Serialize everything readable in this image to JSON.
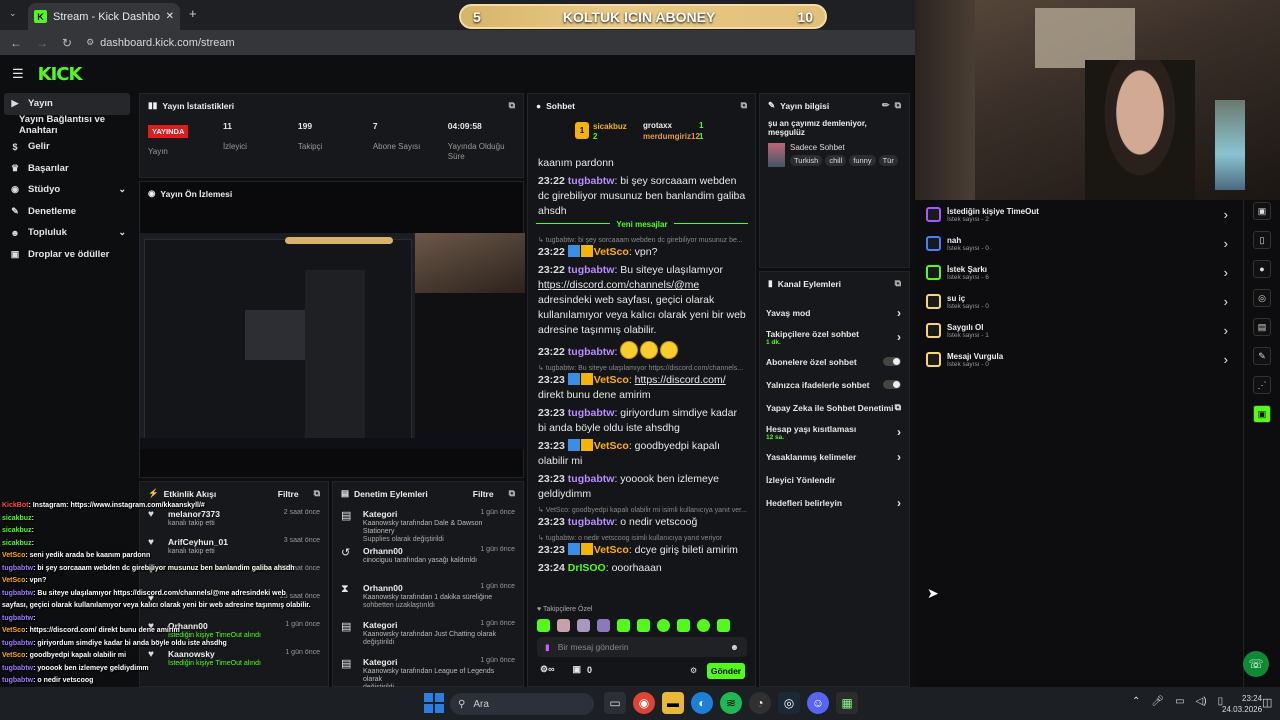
{
  "browser": {
    "tab_title": "Stream - Kick Dashboard",
    "url": "dashboard.kick.com/stream"
  },
  "goal_overlay": {
    "current": "5",
    "label": "KOLTUK ICIN ABONEY",
    "target": "10"
  },
  "sidebar": {
    "items": [
      {
        "label": "Yayın",
        "icon": "video-icon"
      },
      {
        "label": "Yayın Bağlantısı ve Anahtarı",
        "icon": ""
      },
      {
        "label": "Gelir",
        "icon": "dollar-icon"
      },
      {
        "label": "Başarılar",
        "icon": "trophy-icon"
      },
      {
        "label": "Stüdyo",
        "icon": "palette-icon"
      },
      {
        "label": "Denetleme",
        "icon": "wrench-icon"
      },
      {
        "label": "Topluluk",
        "icon": "users-icon"
      },
      {
        "label": "Droplar ve ödüller",
        "icon": "gift-icon"
      }
    ]
  },
  "stats": {
    "title": "Yayın İstatistikleri",
    "live": "YAYINDA",
    "live_label": "Yayın",
    "viewers": "11",
    "viewers_label": "İzleyici",
    "followers": "199",
    "followers_label": "Takipçi",
    "subs": "7",
    "subs_label": "Abone Sayısı",
    "uptime": "04:09:58",
    "uptime_label": "Yayında Olduğu Süre"
  },
  "preview": {
    "title": "Yayın Ön İzlemesi"
  },
  "activity": {
    "title": "Etkinlik Akışı",
    "filter": "Filtre",
    "items": [
      {
        "name": "melanor7373",
        "sub": "kanalı takip etti",
        "time": "2 saat önce"
      },
      {
        "name": "ArifCeyhun_01",
        "sub": "kanalı takip etti",
        "time": "3 saat önce"
      },
      {
        "name": "",
        "sub": "",
        "time": "23 saat önce"
      },
      {
        "name": "",
        "sub": "",
        "time": "23 saat önce"
      },
      {
        "name": "Orhann00",
        "sub": "İstediğin kişiye TimeOut alındı",
        "time": "1 gün önce"
      },
      {
        "name": "Kaanowsky",
        "sub": "İstediğin kişiye TimeOut alındı",
        "time": "1 gün önce"
      }
    ]
  },
  "moderation": {
    "title": "Denetim Eylemleri",
    "filter": "Filtre",
    "items": [
      {
        "name": "Kategori",
        "l1": "Kaanowsky tarafından Dale & Dawson Stationery",
        "l2": "Supplies olarak değiştirildi",
        "time": "1 gün önce",
        "icon": "category-icon"
      },
      {
        "name": "Orhann00",
        "l1": "cinociguu tarafından yasağı kaldırıldı",
        "l2": "",
        "time": "1 gün önce",
        "icon": "undo-icon"
      },
      {
        "name": "Orhann00",
        "l1": "Kaanowsky tarafından 1 dakika süreliğine",
        "l2": "sohbetten uzaklaştırıldı",
        "time": "1 gün önce",
        "icon": "hourglass-icon"
      },
      {
        "name": "Kategori",
        "l1": "Kaanowsky tarafından Just Chatting olarak",
        "l2": "değiştirildi",
        "time": "1 gün önce",
        "icon": "category-icon"
      },
      {
        "name": "Kategori",
        "l1": "Kaanowsky tarafından League of Legends olarak",
        "l2": "değiştirildi",
        "time": "1 gün önce",
        "icon": "category-icon"
      }
    ]
  },
  "chat": {
    "title": "Sohbet",
    "top": {
      "rank1": "sicakbuz",
      "rank1_n": "2",
      "rank2": "grotaxx",
      "rank2_n": "1",
      "rank3": "merdumgiriz12",
      "rank3_n": "1"
    },
    "new_messages": "Yeni mesajlar",
    "messages": [
      {
        "type": "plain",
        "text": "kaanım pardonn"
      },
      {
        "type": "msg",
        "time": "23:22",
        "user": "tugbabtw",
        "text": "bi şey sorcaaam webden dc girebiliyor musunuz ben banlandim galiba ahsdh"
      },
      {
        "type": "reply",
        "text": "tugbabtw: bi şey sorcaaam webden dc girebiliyor musunuz be..."
      },
      {
        "type": "msg",
        "time": "23:22",
        "user": "VetSco",
        "text": "vpn?"
      },
      {
        "type": "msg",
        "time": "23:22",
        "user": "tugbabtw",
        "text": "Bu siteye ulaşılamıyor",
        "link": "https://discord.com/channels/@me",
        "text2": "adresindeki web sayfası, geçici olarak kullanılamıyor veya kalıcı olarak yeni bir web adresine taşınmış olabilir."
      },
      {
        "type": "msg",
        "time": "23:22",
        "user": "tugbabtw",
        "text": ""
      },
      {
        "type": "reply",
        "text": "tugbabtw: Bu siteye ulaşılamıyor https://discord.com/channels..."
      },
      {
        "type": "msg",
        "time": "23:23",
        "user": "VetSco",
        "link": "https://discord.com/",
        "text2": "direkt bunu dene amirim"
      },
      {
        "type": "msg",
        "time": "23:23",
        "user": "tugbabtw",
        "text": "giriyordum simdiye kadar bi anda böyle oldu iste ahsdhg"
      },
      {
        "type": "msg",
        "time": "23:23",
        "user": "VetSco",
        "text": "goodbyedpi kapalı olabilir mi"
      },
      {
        "type": "msg",
        "time": "23:23",
        "user": "tugbabtw",
        "text": "yooook ben izlemeye geldiydimm"
      },
      {
        "type": "reply",
        "text": "VetSco: goodbyedpi kapalı olabilir mi isimli kullanıcıya yanıt ver..."
      },
      {
        "type": "msg",
        "time": "23:23",
        "user": "tugbabtw",
        "text": "o nedir vetscooğ"
      },
      {
        "type": "reply",
        "text": "tugbabtw: o nedir vetscoog isimli kullanıcıya yanıt veriyor"
      },
      {
        "type": "msg",
        "time": "23:23",
        "user": "VetSco",
        "text": "dcye giriş bileti amirim"
      },
      {
        "type": "msg",
        "time": "23:24",
        "user": "DrISOO",
        "text": "ooorhaaan"
      }
    ],
    "followers_only": "Takipçilere Özel",
    "input_placeholder": "Bir mesaj gönderin",
    "points": "0",
    "send": "Gönder"
  },
  "stream_info": {
    "title": "Yayın bilgisi",
    "stream_title": "şu an çayımız demleniyor, meşgulüz",
    "category": "Sadece Sohbet",
    "tags": [
      "Turkish",
      "chill",
      "funny",
      "Tür"
    ]
  },
  "channel_actions": {
    "title": "Kanal Eylemleri",
    "items": [
      {
        "label": "Yavaş mod",
        "kind": "chev",
        "sub": ""
      },
      {
        "label": "Takipçilere özel sohbet",
        "kind": "chev",
        "sub": "1 dk."
      },
      {
        "label": "Abonelere özel sohbet",
        "kind": "toggle",
        "sub": ""
      },
      {
        "label": "Yalnızca ifadelerle sohbet",
        "kind": "toggle",
        "sub": ""
      },
      {
        "label": "Yapay Zeka ile Sohbet Denetimi",
        "kind": "ext",
        "sub": ""
      },
      {
        "label": "Hesap yaşı kısıtlaması",
        "kind": "chev",
        "sub": "12 sa."
      },
      {
        "label": "Yasaklanmış kelimeler",
        "kind": "chev",
        "sub": ""
      },
      {
        "label": "İzleyici Yönlendir",
        "kind": "none",
        "sub": ""
      },
      {
        "label": "Hedefleri belirleyin",
        "kind": "chev",
        "sub": ""
      }
    ]
  },
  "redeems": [
    {
      "name": "İstediğin kişiye TimeOut",
      "sub": "İstek sayısı - 2",
      "color": "#a15cff"
    },
    {
      "name": "nah",
      "sub": "İstek sayısı - 0",
      "color": "#4a7dff"
    },
    {
      "name": "İstek Şarkı",
      "sub": "İstek sayısı - 6",
      "color": "#53fc18"
    },
    {
      "name": "su iç",
      "sub": "İstek sayısı - 0",
      "color": "#f5d76e"
    },
    {
      "name": "Saygılı Ol",
      "sub": "İstek sayısı - 1",
      "color": "#f5d76e"
    },
    {
      "name": "Mesajı Vurgula",
      "sub": "İstek sayısı - 0",
      "color": "#f5d76e"
    }
  ],
  "overlay_chat": [
    {
      "user": "KickBot",
      "text": ": Instagram: https://www.instagram.com/kkaanskyll/#",
      "c": "n3"
    },
    {
      "user": "sicakbuz",
      "text": ": ",
      "c": "n4"
    },
    {
      "user": "sicakbuz",
      "text": ": ",
      "c": "n4"
    },
    {
      "user": "sicakbuz",
      "text": ": ",
      "c": "n4"
    },
    {
      "user": "VetSco",
      "text": ": seni yedik arada be kaanım pardonn",
      "c": "n2"
    },
    {
      "user": "tugbabtw",
      "text": ": bi şey sorcaaam webden dc girebiliyor musunuz ben banlandim galiba ahsdh",
      "c": "n1"
    },
    {
      "user": "VetSco",
      "text": ": vpn?",
      "c": "n2"
    },
    {
      "user": "tugbabtw",
      "text": ": Bu siteye ulaşılamıyor https://discord.com/channels/@me adresindeki web",
      "c": "n1"
    },
    {
      "user": "",
      "text": "sayfası, geçici olarak kullanılamıyor veya kalıcı olarak yeni bir web adresine taşınmış olabilir.",
      "c": ""
    },
    {
      "user": "tugbabtw",
      "text": ":",
      "c": "n1"
    },
    {
      "user": "VetSco",
      "text": ": https://discord.com/ direkt bunu dene amirim",
      "c": "n2"
    },
    {
      "user": "tugbabtw",
      "text": ": giriyordum simdiye kadar bi anda böyle oldu iste ahsdhg",
      "c": "n1"
    },
    {
      "user": "VetSco",
      "text": ": goodbyedpi kapalı olabilir mi",
      "c": "n2"
    },
    {
      "user": "tugbabtw",
      "text": ": yooook ben izlemeye geldiydimm",
      "c": "n1"
    },
    {
      "user": "tugbabtw",
      "text": ": o nedir vetscoog",
      "c": "n1"
    },
    {
      "user": "VetSco",
      "text": ": dcye giriş bileti amirim",
      "c": "n2"
    },
    {
      "user": "DrISOO",
      "text": ": ooorhaaan",
      "c": "n5"
    }
  ],
  "taskbar": {
    "search": "Ara",
    "time": "23:24",
    "date": "24.03.2026"
  }
}
